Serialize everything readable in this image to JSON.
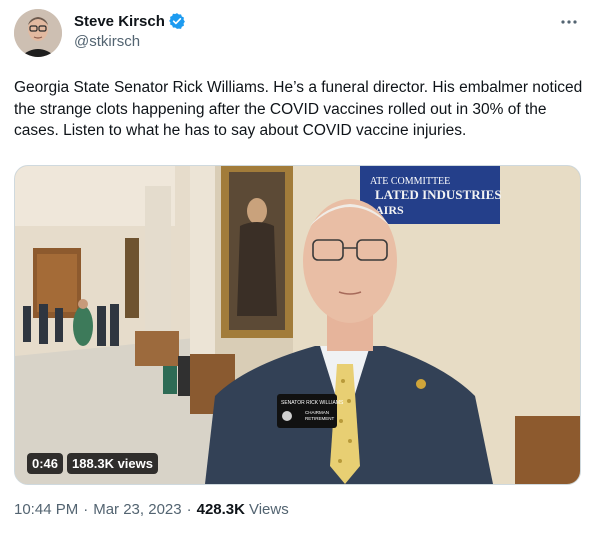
{
  "author": {
    "display_name": "Steve Kirsch",
    "handle": "@stkirsch",
    "verified_color": "#1d9bf0"
  },
  "tweet": {
    "text": "Georgia State Senator Rick Williams. He’s a funeral director. His embalmer noticed the strange clots happening after the COVID vaccines rolled out in 30% of the cases. Listen to what he has to say about COVID vaccine injuries."
  },
  "video": {
    "duration": "0:46",
    "views": "188.3K views",
    "banner_line1": "ATE COMMITTEE",
    "banner_line2": "LATED INDUSTRIES",
    "banner_line3": "AIRS",
    "name_badge_line1": "SENATOR RICK WILLIAMS",
    "name_badge_line2": "CHAIRMAN",
    "name_badge_line3": "RETIREMENT"
  },
  "footer": {
    "time": "10:44 PM",
    "dot1": "·",
    "date": "Mar 23, 2023",
    "dot2": "·",
    "views_count": "428.3K",
    "views_label": "Views"
  },
  "icons": {
    "verified": "verified-badge-icon",
    "more": "more-options-icon"
  }
}
